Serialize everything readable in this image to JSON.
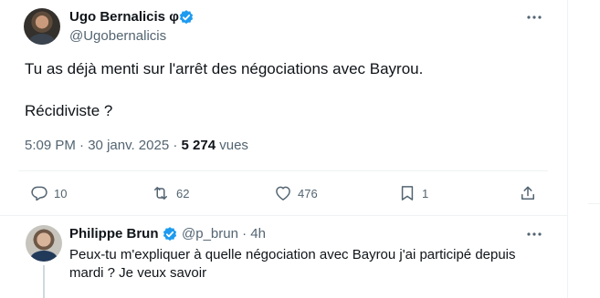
{
  "tweet": {
    "author": {
      "display_name": "Ugo Bernalicis φ",
      "handle": "@Ugobernalicis"
    },
    "text_line_1": "Tu as déjà menti sur l'arrêt des négociations avec Bayrou.",
    "text_line_2": "Récidiviste ?",
    "time": "5:09 PM",
    "separator": " · ",
    "date": "30 janv. 2025",
    "views_count": "5 274",
    "views_label": " vues",
    "actions": {
      "replies": "10",
      "reposts": "62",
      "likes": "476",
      "bookmarks": "1"
    }
  },
  "reply": {
    "author": {
      "display_name": "Philippe Brun",
      "handle": "@p_brun",
      "time": "4h",
      "handle_time_sep": " · "
    },
    "text": "Peux-tu m'expliquer à quelle négociation avec Bayrou j'ai participé depuis mardi ? Je veux savoir"
  },
  "colors": {
    "accent": "#1d9bf0",
    "secondary_text": "#536471",
    "primary_text": "#0f1419",
    "border": "#eff3f4"
  },
  "icons": {
    "verified": "verified-badge-icon",
    "more": "more-dots-icon",
    "reply": "reply-bubble-icon",
    "repost": "repost-icon",
    "like": "heart-icon",
    "bookmark": "bookmark-icon",
    "share": "share-upload-icon"
  }
}
